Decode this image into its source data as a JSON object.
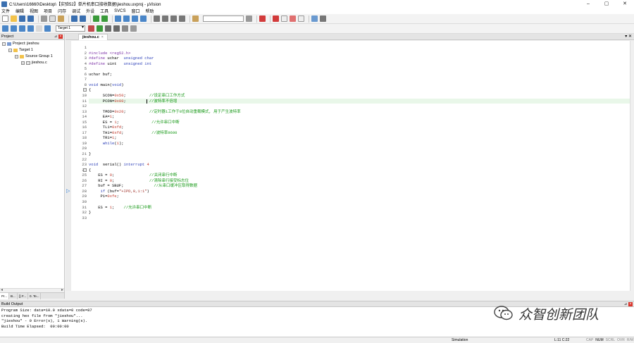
{
  "window": {
    "title": "C:\\Users\\16660\\Desktop\\【实验52】单片机串口接收数据\\jieshou.uvproj - µVision",
    "minimize_icon": "minimize-icon",
    "maximize_icon": "maximize-icon",
    "close_icon": "close-icon"
  },
  "menu": {
    "items": [
      "文件",
      "编辑",
      "视图",
      "项目",
      "闪存",
      "调试",
      "外设",
      "工具",
      "SVCS",
      "窗口",
      "帮助"
    ]
  },
  "toolbar2": {
    "target": "Target 1"
  },
  "project_panel": {
    "header": "Project",
    "tree": [
      {
        "label": "Project: jieshou",
        "indent": 0,
        "icon": "project-icon",
        "expander": "−"
      },
      {
        "label": "Target 1",
        "indent": 1,
        "icon": "target-folder-icon",
        "expander": "−"
      },
      {
        "label": "Source Group 1",
        "indent": 2,
        "icon": "folder-icon",
        "expander": "−"
      },
      {
        "label": "jieshou.c",
        "indent": 3,
        "icon": "c-file-icon",
        "expander": "+"
      }
    ],
    "tabs": [
      "Pr...",
      "B...",
      "{} F...",
      "0. Te..."
    ]
  },
  "editor": {
    "tab_label": "jieshou.c",
    "tab_close": "×",
    "lines": [
      {
        "n": "1",
        "html": ""
      },
      {
        "n": "2",
        "tokens": [
          [
            "pp",
            "#include <reg52.h>"
          ]
        ]
      },
      {
        "n": "3",
        "tokens": [
          [
            "pp",
            "#define "
          ],
          [
            "",
            "uchar  "
          ],
          [
            "kw",
            "unsigned char"
          ]
        ]
      },
      {
        "n": "4",
        "tokens": [
          [
            "pp",
            "#define "
          ],
          [
            "",
            "uint   "
          ],
          [
            "kw",
            "unsigned int"
          ]
        ]
      },
      {
        "n": "5",
        "tokens": []
      },
      {
        "n": "6",
        "tokens": [
          [
            "",
            "uchar buf;"
          ]
        ]
      },
      {
        "n": "7",
        "tokens": []
      },
      {
        "n": "8",
        "tokens": [
          [
            "kw",
            "void "
          ],
          [
            "",
            "main("
          ],
          [
            "kw",
            "void"
          ],
          [
            "",
            ")"
          ]
        ]
      },
      {
        "n": "9",
        "fold": true,
        "tokens": [
          [
            "",
            "{"
          ]
        ]
      },
      {
        "n": "10",
        "tokens": [
          [
            "",
            "      SCON="
          ],
          [
            "nm",
            "0x50"
          ],
          [
            "",
            ";          "
          ],
          [
            "cm",
            "//设定串口工作方式"
          ]
        ]
      },
      {
        "n": "11",
        "hl": true,
        "caret": true,
        "tokens": [
          [
            "",
            "      PCON="
          ],
          [
            "nm",
            "0x00"
          ],
          [
            "",
            ";          "
          ],
          [
            "cm",
            "//波特率不倍增"
          ]
        ]
      },
      {
        "n": "12",
        "tokens": []
      },
      {
        "n": "13",
        "tokens": [
          [
            "",
            "      TMOD="
          ],
          [
            "nm",
            "0x20"
          ],
          [
            "",
            ";          "
          ],
          [
            "cm",
            "//定时器1工作于8位自动重载模式, 用于产生波特率"
          ]
        ]
      },
      {
        "n": "14",
        "tokens": [
          [
            "",
            "      EA="
          ],
          [
            "nm",
            "1"
          ],
          [
            "",
            ";"
          ]
        ]
      },
      {
        "n": "15",
        "tokens": [
          [
            "",
            "      ES = "
          ],
          [
            "nm",
            "1"
          ],
          [
            "",
            ";              "
          ],
          [
            "cm",
            "//允许串口中断"
          ]
        ]
      },
      {
        "n": "16",
        "tokens": [
          [
            "",
            "      TL1="
          ],
          [
            "nm",
            "0xfd"
          ],
          [
            "",
            ";"
          ]
        ]
      },
      {
        "n": "17",
        "tokens": [
          [
            "",
            "      TH1="
          ],
          [
            "nm",
            "0xfd"
          ],
          [
            "",
            ";            "
          ],
          [
            "cm",
            "//波特率9600"
          ]
        ]
      },
      {
        "n": "18",
        "tokens": [
          [
            "",
            "      TR1="
          ],
          [
            "nm",
            "1"
          ],
          [
            "",
            ";"
          ]
        ]
      },
      {
        "n": "19",
        "tokens": [
          [
            "",
            "      "
          ],
          [
            "kw",
            "while"
          ],
          [
            "",
            "("
          ],
          [
            "nm",
            "1"
          ],
          [
            "",
            ");"
          ]
        ]
      },
      {
        "n": "20",
        "tokens": []
      },
      {
        "n": "21",
        "tokens": [
          [
            "",
            "}"
          ]
        ]
      },
      {
        "n": "22",
        "tokens": []
      },
      {
        "n": "23",
        "tokens": [
          [
            "kw",
            "void  "
          ],
          [
            "",
            "serial() "
          ],
          [
            "kw",
            "interrupt "
          ],
          [
            "nm",
            "4"
          ]
        ]
      },
      {
        "n": "24",
        "fold": true,
        "tokens": [
          [
            "",
            "{"
          ]
        ]
      },
      {
        "n": "25",
        "tokens": [
          [
            "",
            "    ES = "
          ],
          [
            "nm",
            "0"
          ],
          [
            "",
            ";               "
          ],
          [
            "cm",
            "//关闭串行中断"
          ]
        ]
      },
      {
        "n": "26",
        "tokens": [
          [
            "",
            "    RI = "
          ],
          [
            "nm",
            "0"
          ],
          [
            "",
            ";               "
          ],
          [
            "cm",
            "//清除串行接受标志位"
          ]
        ]
      },
      {
        "n": "27",
        "tokens": [
          [
            "",
            "    buf = SBUF;             "
          ],
          [
            "cm",
            "//从串口缓冲区取得数据"
          ]
        ]
      },
      {
        "n": "28",
        "arrow": true,
        "tokens": [
          [
            "",
            "     "
          ],
          [
            "kw",
            "if "
          ],
          [
            "",
            "(buf="
          ],
          [
            "st",
            "\"+IPD,0,1:1\""
          ],
          [
            "",
            ")"
          ]
        ]
      },
      {
        "n": "29",
        "tokens": [
          [
            "",
            "     P1="
          ],
          [
            "nm",
            "0xfe"
          ],
          [
            "",
            ";"
          ]
        ]
      },
      {
        "n": "30",
        "tokens": []
      },
      {
        "n": "31",
        "tokens": [
          [
            "",
            "    ES = "
          ],
          [
            "nm",
            "1"
          ],
          [
            "",
            ";    "
          ],
          [
            "cm",
            "//允许串口中断"
          ]
        ]
      },
      {
        "n": "32",
        "tokens": [
          [
            "",
            "}"
          ]
        ]
      },
      {
        "n": "33",
        "tokens": []
      }
    ]
  },
  "build": {
    "header": "Build Output",
    "lines": [
      "Program Size: data=10.0 xdata=0 code=87",
      "creating hex file from \"jieshou\"...",
      "\"jieshou\" - 0 Error(s), 1 Warning(s).",
      "Build Time Elapsed:  00:00:00"
    ]
  },
  "watermark": {
    "text": "众智创新团队"
  },
  "status": {
    "mode": "Simulation",
    "position": "L:11 C:22",
    "keys": [
      {
        "label": "CAP",
        "on": false
      },
      {
        "label": "NUM",
        "on": true
      },
      {
        "label": "SCRL",
        "on": false
      },
      {
        "label": "OVR",
        "on": false
      },
      {
        "label": "R/W",
        "on": false
      }
    ]
  },
  "colors": {
    "preprocessor": "#7b2fa6",
    "keyword": "#2c3fb8",
    "comment": "#1a9a1a",
    "number": "#c0392b",
    "highlight_line": "#e9f7e9",
    "exec_arrow": "#2b7bd8"
  }
}
